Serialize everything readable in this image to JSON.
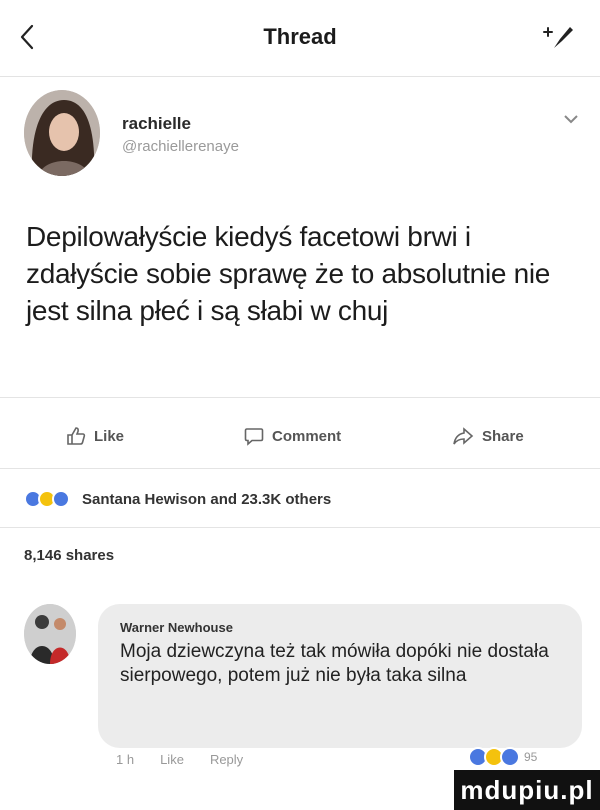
{
  "header": {
    "title": "Thread"
  },
  "post": {
    "author_name": "rachielle",
    "author_handle": "@rachiellerenaye",
    "text": "Depilowałyście kiedyś facetowi brwi i zdałyście sobie sprawę że to absolutnie nie jest silna płeć i są słabi w chuj"
  },
  "actions": {
    "like": "Like",
    "comment": "Comment",
    "share": "Share"
  },
  "reactions": {
    "summary": "Santana Hewison and 23.3K others"
  },
  "shares": "8,146 shares",
  "comment": {
    "author": "Warner Newhouse",
    "text": "Moja dziewczyna też tak mówiła dopóki nie dostała sierpowego, potem już nie była taka silna",
    "time": "1 h",
    "like": "Like",
    "reply": "Reply",
    "reaction_count": "95"
  },
  "watermark": "mdupiu.pl",
  "colors": {
    "like_blue": "#4a78e0",
    "laugh_yellow": "#f4c20d",
    "divider": "#e4e4e4"
  },
  "icons": [
    "back-chevron-icon",
    "compose-icon",
    "caret-down-icon",
    "thumbs-up-icon",
    "comment-icon",
    "share-icon"
  ]
}
